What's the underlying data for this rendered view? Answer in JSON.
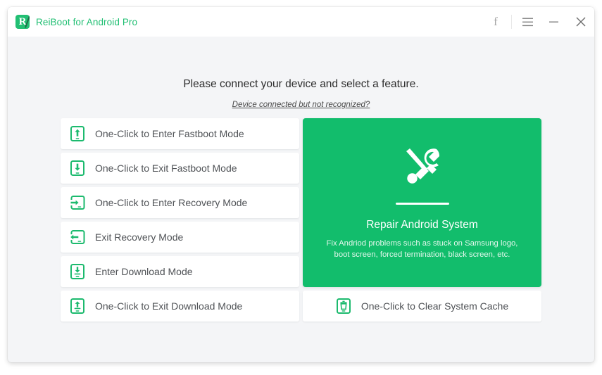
{
  "window": {
    "brand_title": "ReiBoot for Android Pro",
    "accent_color": "#21bf73",
    "panel_green": "#12bd6c",
    "body_background": "#f4f5f7"
  },
  "titlebar": {
    "facebook_label": "f",
    "menu_label": "menu",
    "minimize_label": "minimize",
    "close_label": "close"
  },
  "header": {
    "headline": "Please connect your device and select a feature.",
    "help_link": "Device connected but not recognized?"
  },
  "modes": [
    {
      "label": "One-Click to Enter Fastboot Mode",
      "icon": "phone-arrow-up-icon"
    },
    {
      "label": "One-Click to Exit Fastboot Mode",
      "icon": "phone-arrow-down-icon"
    },
    {
      "label": "One-Click to Enter Recovery Mode",
      "icon": "phone-arrow-in-icon"
    },
    {
      "label": "Exit Recovery Mode",
      "icon": "phone-arrow-out-icon"
    },
    {
      "label": "Enter Download Mode",
      "icon": "phone-download-icon"
    },
    {
      "label": "One-Click to Exit Download Mode",
      "icon": "phone-upload-icon"
    }
  ],
  "repair": {
    "title": "Repair Android System",
    "description": "Fix Andriod problems such as stuck on Samsung logo, boot screen, forced termination, black screen, etc.",
    "icon": "wrench-screwdriver-icon"
  },
  "cache": {
    "label": "One-Click to Clear System Cache",
    "icon": "phone-trash-icon"
  }
}
